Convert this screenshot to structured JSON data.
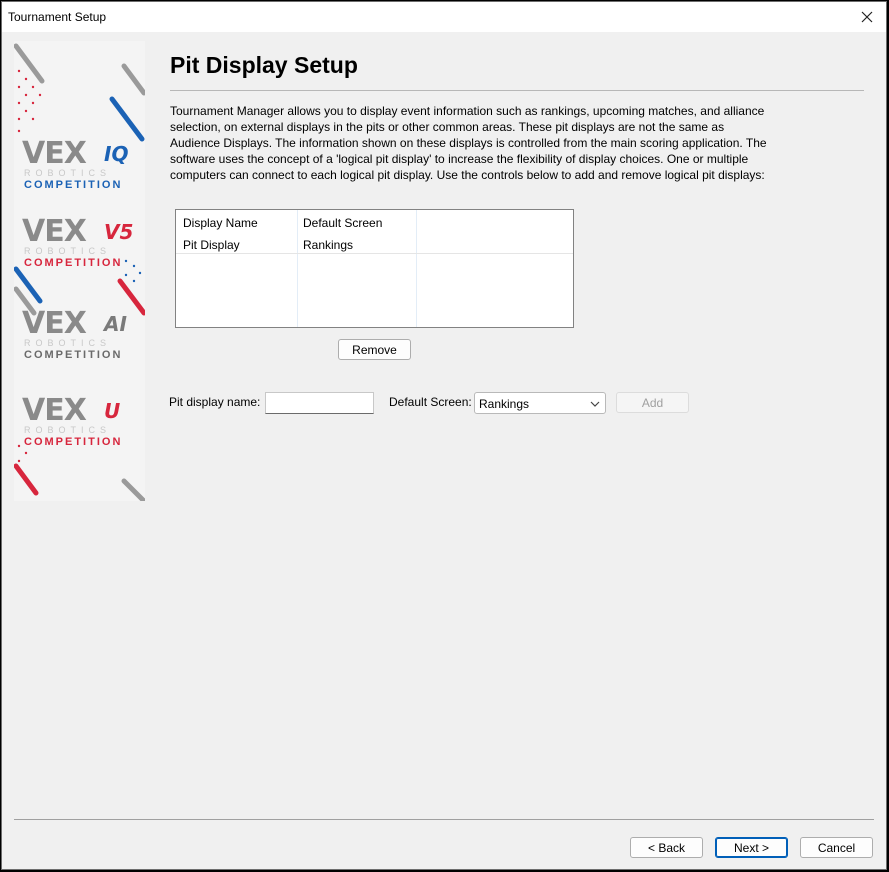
{
  "window": {
    "title": "Tournament Setup"
  },
  "banner": {
    "logos": [
      {
        "brand": "VEX",
        "suffix": "IQ",
        "robotics": "ROBOTICS",
        "competition": "COMPETITION",
        "accent": "#1b62b5"
      },
      {
        "brand": "VEX",
        "suffix": "V5",
        "robotics": "ROBOTICS",
        "competition": "COMPETITION",
        "accent": "#d7263d"
      },
      {
        "brand": "VEX",
        "suffix": "AI",
        "robotics": "ROBOTICS",
        "competition": "COMPETITION",
        "accent": "#7a7a7a"
      },
      {
        "brand": "VEX",
        "suffix": "U",
        "robotics": "ROBOTICS",
        "competition": "COMPETITION",
        "accent": "#d7263d"
      }
    ]
  },
  "page": {
    "heading": "Pit Display Setup",
    "description": "Tournament Manager allows you to display event information such as rankings, upcoming matches, and alliance selection, on external displays in the pits or other common areas.  These pit displays are not the same as Audience Displays.  The information shown on these displays is controlled from the main scoring application.  The software uses the concept of a 'logical pit display' to increase the flexibility of display choices.  One or multiple computers can connect to each logical pit display.  Use the controls below to add and remove logical pit displays:"
  },
  "list": {
    "columns": [
      "Display Name",
      "Default Screen"
    ],
    "rows": [
      {
        "name": "Pit Display",
        "screen": "Rankings"
      }
    ]
  },
  "buttons": {
    "remove": "Remove",
    "add": "Add",
    "back": "< Back",
    "next": "Next >",
    "cancel": "Cancel"
  },
  "form": {
    "name_label": "Pit display name:",
    "name_value": "",
    "screen_label": "Default Screen:",
    "screen_value": "Rankings"
  },
  "colors": {
    "blue": "#1b62b5",
    "red": "#d7263d",
    "gray": "#8a8a8a",
    "focus": "#005fb8"
  }
}
